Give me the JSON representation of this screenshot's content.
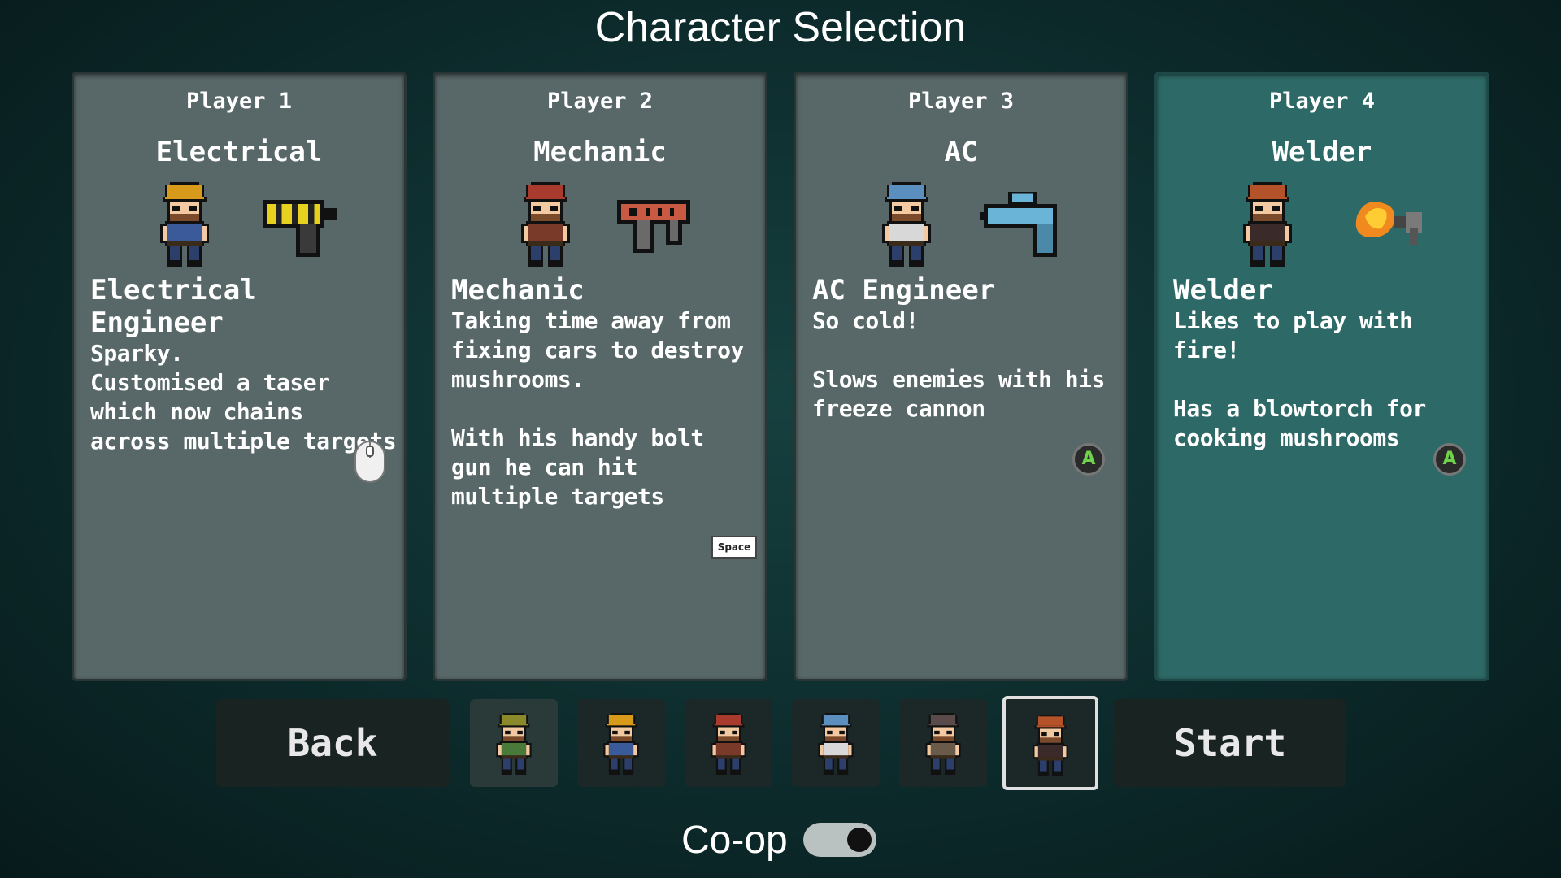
{
  "title": "Character Selection",
  "players": [
    {
      "label": "Player 1",
      "class": "Electrical",
      "desc_title": "Electrical Engineer",
      "desc_body": "Sparky.\nCustomised a taser\nwhich now chains\nacross multiple targets",
      "input": "mouse-icon",
      "helmet": "#d79a1a",
      "shirt": "#3b5a9a",
      "selected": false
    },
    {
      "label": "Player 2",
      "class": "Mechanic",
      "desc_title": "Mechanic",
      "desc_body": "Taking time away from\nfixing cars to destroy\nmushrooms.\n\nWith his handy bolt\ngun he can hit\nmultiple targets",
      "input": "space-key-icon",
      "input_text": "Space",
      "helmet": "#a83a2e",
      "shirt": "#7a3a2a",
      "selected": false
    },
    {
      "label": "Player 3",
      "class": "AC",
      "desc_title": "AC Engineer",
      "desc_body": "So cold!\n\nSlows enemies with his\nfreeze cannon",
      "input": "a-button-icon",
      "input_text": "A",
      "helmet": "#5b8fc0",
      "shirt": "#d8d8d8",
      "selected": false
    },
    {
      "label": "Player 4",
      "class": "Welder",
      "desc_title": "Welder",
      "desc_body": "Likes to play with fire!\n\nHas a blowtorch for\ncooking mushrooms",
      "input": "a-button-icon",
      "input_text": "A",
      "helmet": "#b4522a",
      "shirt": "#3a2a2a",
      "selected": true
    }
  ],
  "bottom": {
    "back_label": "Back",
    "start_label": "Start",
    "roster": [
      {
        "name": "green-worker",
        "helmet": "#8a8a2a",
        "shirt": "#4a7a3a"
      },
      {
        "name": "electrical",
        "helmet": "#d79a1a",
        "shirt": "#3b5a9a"
      },
      {
        "name": "mechanic",
        "helmet": "#a83a2e",
        "shirt": "#7a3a2a"
      },
      {
        "name": "ac",
        "helmet": "#5b8fc0",
        "shirt": "#d8d8d8"
      },
      {
        "name": "brown-worker",
        "helmet": "#5a4a4a",
        "shirt": "#6a5a4a"
      },
      {
        "name": "welder",
        "helmet": "#b4522a",
        "shirt": "#3a2a2a"
      }
    ]
  },
  "coop": {
    "label": "Co-op",
    "enabled": true
  }
}
